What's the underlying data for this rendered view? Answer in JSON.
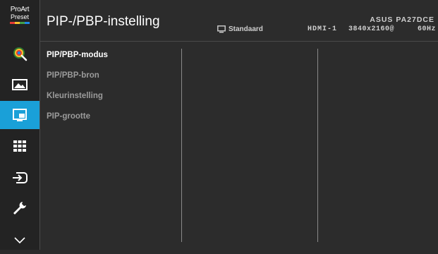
{
  "logo": {
    "line1": "ProArt",
    "line2": "Preset"
  },
  "sidebar": {
    "items": [
      {
        "name": "color-icon",
        "active": false
      },
      {
        "name": "image-icon",
        "active": false
      },
      {
        "name": "pip-pbp-icon",
        "active": true
      },
      {
        "name": "quickfit-icon",
        "active": false
      },
      {
        "name": "input-select-icon",
        "active": false
      },
      {
        "name": "system-setup-icon",
        "active": false
      },
      {
        "name": "chevron-down-icon",
        "active": false
      }
    ]
  },
  "header": {
    "title": "PIP-/PBP-instelling",
    "mode": "Standaard",
    "model": "ASUS PA27DCE",
    "input": "HDMI-1",
    "resolution": "3840x2160@",
    "refresh": "60Hz"
  },
  "menu": {
    "items": [
      {
        "label": "PIP/PBP-modus",
        "selected": true
      },
      {
        "label": "PIP/PBP-bron",
        "selected": false
      },
      {
        "label": "Kleurinstelling",
        "selected": false
      },
      {
        "label": "PIP-grootte",
        "selected": false
      }
    ]
  },
  "colors": {
    "accent": "#1aa0d8",
    "background": "#2c2c2c",
    "sidebar": "#232323"
  }
}
